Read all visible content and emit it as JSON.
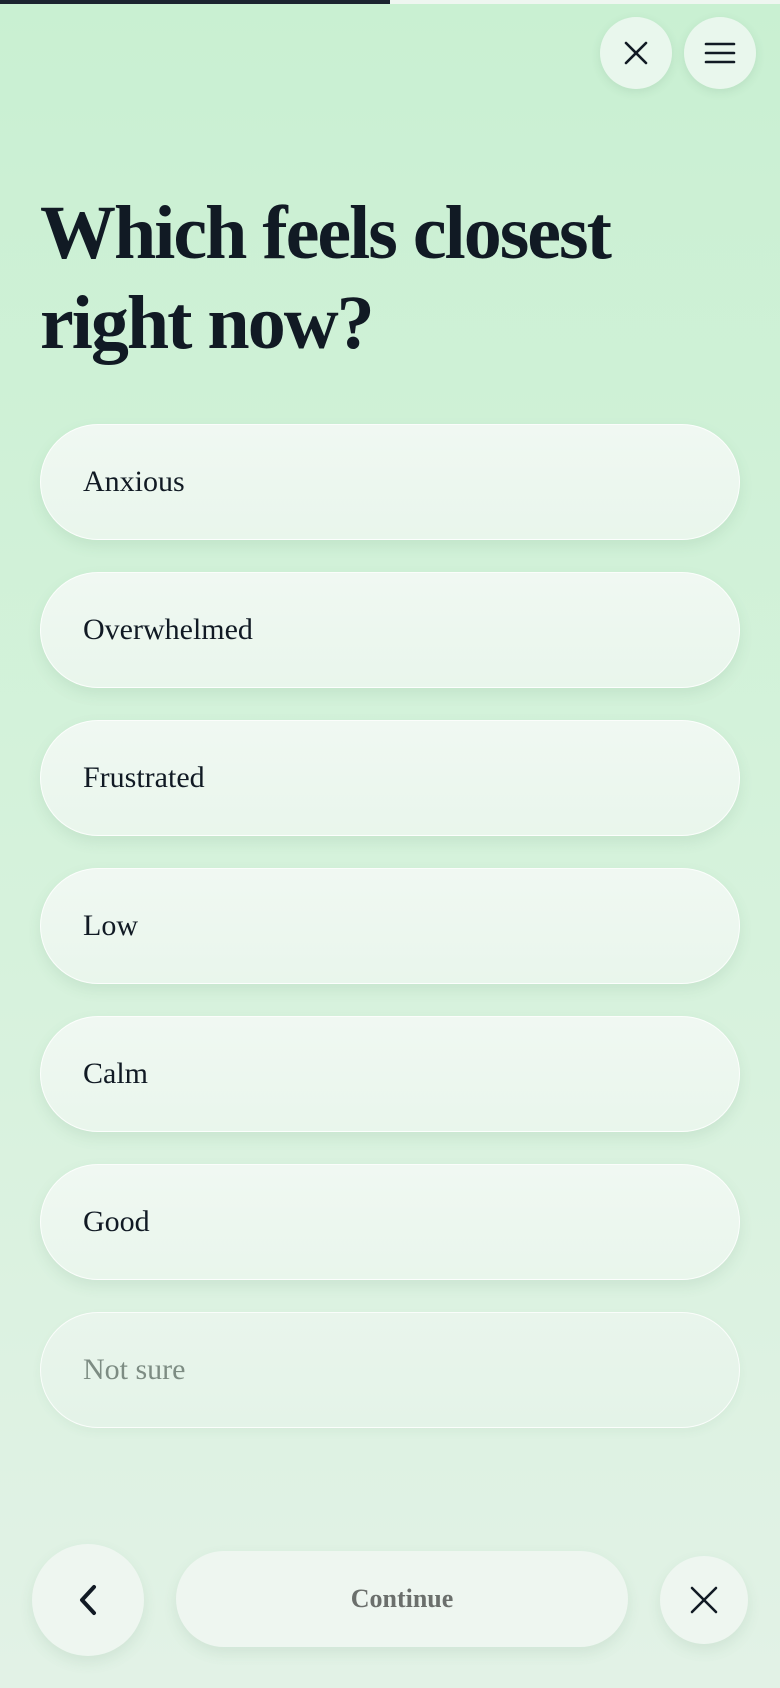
{
  "progress": {
    "fraction": 0.5
  },
  "header": {
    "close_icon": "close-icon",
    "menu_icon": "hamburger-menu-icon"
  },
  "question": {
    "title": "Which feels closest right now?"
  },
  "options": [
    {
      "label": "Anxious"
    },
    {
      "label": "Overwhelmed"
    },
    {
      "label": "Frustrated"
    },
    {
      "label": "Low"
    },
    {
      "label": "Calm"
    },
    {
      "label": "Good"
    },
    {
      "label": "Not sure"
    }
  ],
  "footer": {
    "back_icon": "chevron-left-icon",
    "continue_label": "Continue",
    "close_icon": "close-icon"
  },
  "colors": {
    "background": "#c9f0d2",
    "text": "#111a24",
    "progress_fill": "#1b2430",
    "muted_text": "#7d8c83"
  }
}
